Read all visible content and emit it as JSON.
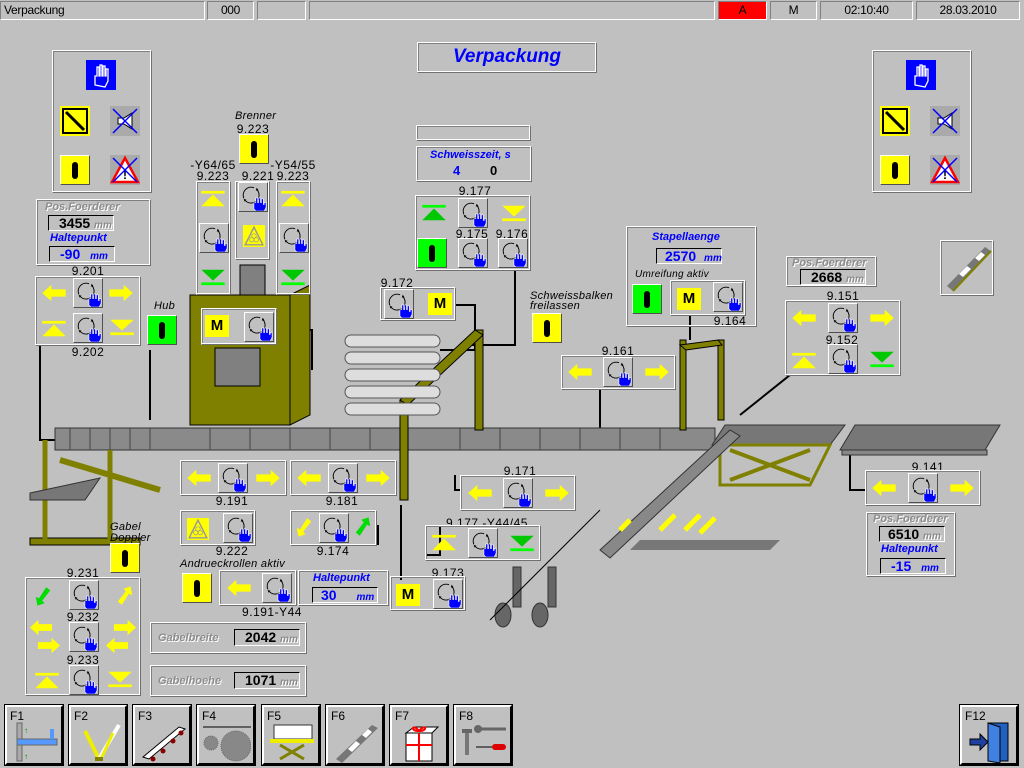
{
  "status_bar": {
    "title": "Verpackung",
    "code": "000",
    "blank1": "",
    "message": "",
    "mode_a": "A",
    "mode_m": "M",
    "time": "02:10:40",
    "date": "28.03.2010",
    "colors": {
      "alarm": "#ff0000"
    }
  },
  "page_title": "Verpackung",
  "buttons": {
    "m": "M"
  },
  "pos_left": {
    "title": "Pos.Foerderer",
    "value": "3455",
    "unit": "mm",
    "halt_title": "Haltepunkt",
    "halt_value": "-90",
    "halt_unit": "mm"
  },
  "pos_right_top": {
    "title": "Pos.Foerderer",
    "value": "2668",
    "unit": "mm"
  },
  "pos_right_bottom": {
    "title": "Pos.Foerderer",
    "value": "6510",
    "unit": "mm",
    "halt_title": "Haltepunkt",
    "halt_value": "-15",
    "halt_unit": "mm"
  },
  "schweisszeit": {
    "title": "Schweisszeit, s",
    "set": "4",
    "actual": "0"
  },
  "stapellaenge": {
    "title": "Stapellaenge",
    "value": "2570",
    "unit": "mm",
    "umreifung": "Umreifung aktiv"
  },
  "haltepunkt_mid": {
    "title": "Haltepunkt",
    "value": "30",
    "unit": "mm"
  },
  "gabelbreite": {
    "label": "Gabelbreite",
    "value": "2042",
    "unit": "mm"
  },
  "gabelhoehe": {
    "label": "Gabelhoehe",
    "value": "1071",
    "unit": "mm"
  },
  "text": {
    "brenner": "Brenner",
    "hub": "Hub",
    "y6465": "-Y64/65",
    "y5455": "-Y54/55",
    "schweissbalken1": "Schweissbalken",
    "schweissbalken2": "freilassen",
    "gabel1": "Gabel",
    "gabel2": "Doppler",
    "andrueck": "Andrueckrollen aktiv"
  },
  "ids": {
    "i9201": "9.201",
    "i9202": "9.202",
    "i9223a": "9.223",
    "i9223b": "9.223",
    "i9223c": "9.223",
    "i9221": "9.221",
    "i9177": "9.177",
    "i9175": "9.175",
    "i9176": "9.176",
    "i9172": "9.172",
    "i9164": "9.164",
    "i9161": "9.161",
    "i9151": "9.151",
    "i9152": "9.152",
    "i9141": "9.141",
    "i9191": "9.191",
    "i9181": "9.181",
    "i9222": "9.222",
    "i9174": "9.174",
    "i9171": "9.171",
    "i9177y": "9.177 -Y44/45",
    "i9191y": "9.191-Y44",
    "i9173": "9.173",
    "i9231": "9.231",
    "i9232": "9.232",
    "i9233": "9.233"
  },
  "function_keys": [
    {
      "key": "F1",
      "icon": "layout-overview-icon"
    },
    {
      "key": "F2",
      "icon": "fork-lift-icon"
    },
    {
      "key": "F3",
      "icon": "conveyor-icon"
    },
    {
      "key": "F4",
      "icon": "saw-icon"
    },
    {
      "key": "F5",
      "icon": "lift-table-icon"
    },
    {
      "key": "F6",
      "icon": "roller-conveyor-icon"
    },
    {
      "key": "F7",
      "icon": "package-icon"
    },
    {
      "key": "F8",
      "icon": "tools-icon"
    },
    {
      "key": "F12",
      "icon": "exit-door-icon"
    }
  ]
}
